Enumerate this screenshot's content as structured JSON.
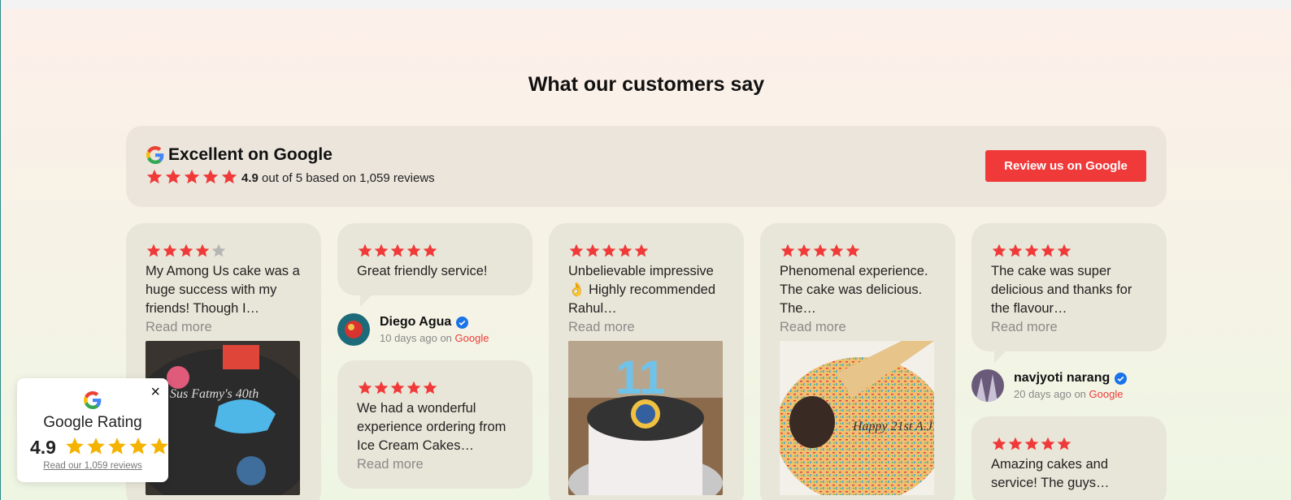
{
  "section": {
    "heading": "What our customers say"
  },
  "summary": {
    "title": "Excellent on Google",
    "score": "4.9",
    "rating_text": " out of 5 based on 1,059 reviews",
    "stars": 5,
    "button_label": "Review us on Google"
  },
  "reviews": [
    {
      "stars": 4,
      "text": "My Among Us cake was a huge success with my friends! Though I…",
      "more": "Read more"
    },
    {
      "stars": 5,
      "text": "Great friendly service!",
      "author": "Diego Agua",
      "time": "10 days ago",
      "on": " on ",
      "source": "Google"
    },
    {
      "stars": 5,
      "text": "We had a wonderful experience ordering from Ice Cream Cakes…",
      "more": "Read more"
    },
    {
      "stars": 5,
      "text": "Unbelievable impressive 👌 Highly recommended Rahul…",
      "more": "Read more"
    },
    {
      "stars": 5,
      "text": "Phenomenal experience. The cake was delicious. The…",
      "more": "Read more"
    },
    {
      "stars": 5,
      "text": "The cake was super delicious and thanks for the flavour…",
      "more": "Read more",
      "author": "navjyoti narang",
      "time": "20 days ago",
      "on": " on ",
      "source": "Google"
    },
    {
      "stars": 5,
      "text": "Amazing cakes and service! The guys…"
    }
  ],
  "photos": {
    "cake1_text": "Sus Fatmy's 40th",
    "cake3_candle": "11",
    "cake4_text": "Happy 21st A.J"
  },
  "badge": {
    "label": "Google Rating",
    "score": "4.9",
    "stars": 5,
    "link": "Read our 1,059 reviews",
    "close": "×"
  },
  "colors": {
    "star": "#f03a3a",
    "star_empty": "#b5b5b5",
    "accent": "#f03a3a",
    "card": "#e8e6d8"
  }
}
